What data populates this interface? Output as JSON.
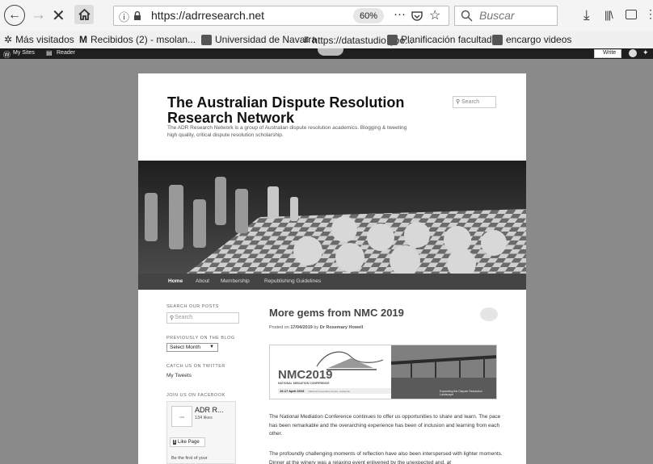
{
  "browser": {
    "url": "https://adrresearch.net",
    "zoom": "60%",
    "search_placeholder": "Buscar"
  },
  "bookmarks": [
    {
      "label": "Más visitados"
    },
    {
      "label": "Recibidos (2) - msolan..."
    },
    {
      "label": "Universidad de Navarra"
    },
    {
      "label": "https://datastudio.goo..."
    },
    {
      "label": "Planificación facultad..."
    },
    {
      "label": "encargo videos"
    }
  ],
  "adminbar": {
    "my_sites": "My Sites",
    "reader": "Reader",
    "write": "Write"
  },
  "site": {
    "title": "The Australian Dispute Resolution Research Network",
    "description": "The ADR Research Network is a group of Australian dispute resolution academics. Blogging & tweeting high quality, critical dispute resolution scholarship.",
    "search_placeholder": "Search"
  },
  "menu": [
    "Home",
    "About",
    "Membership",
    "Republishing Guidelines"
  ],
  "sidebar": {
    "search_label": "SEARCH OUR POSTS",
    "search_placeholder": "Search",
    "archive_label": "PREVIOUSLY ON THE BLOG",
    "archive_value": "Select Month",
    "twitter_label": "CATCH US ON TWITTER",
    "twitter_link": "My Tweets",
    "facebook_label": "JOIN US ON FACEBOOK",
    "fb_page_name": "ADR R...",
    "fb_likes": "134 likes",
    "fb_like_button": "Like Page",
    "fb_first": "Be the first of your"
  },
  "post": {
    "title": "More gems from NMC 2019",
    "meta_prefix": "Posted on",
    "date": "17/04/2019",
    "meta_by": "by",
    "author": "Dr Rosemary Howell",
    "banner_title": "NMC2019",
    "banner_subtitle": "NATIONAL MEDIATION CONFERENCE",
    "banner_dates": "15-17 April 2019",
    "banner_venue": "National Convention Centre, Canberra",
    "banner_tagline": "Expanding the Dispute Resolution Landscape",
    "paragraph1": "The National Mediation Conference continues to offer us opportunities to share and learn. The pace has been remarkable and the overarching experience has been of inclusion and learning from each other.",
    "paragraph2": "The profoundly challenging moments of reflection have also been interspersed with lighter moments. Dinner at the winery was a relaxing event enlivened by the unexpected and, at"
  }
}
